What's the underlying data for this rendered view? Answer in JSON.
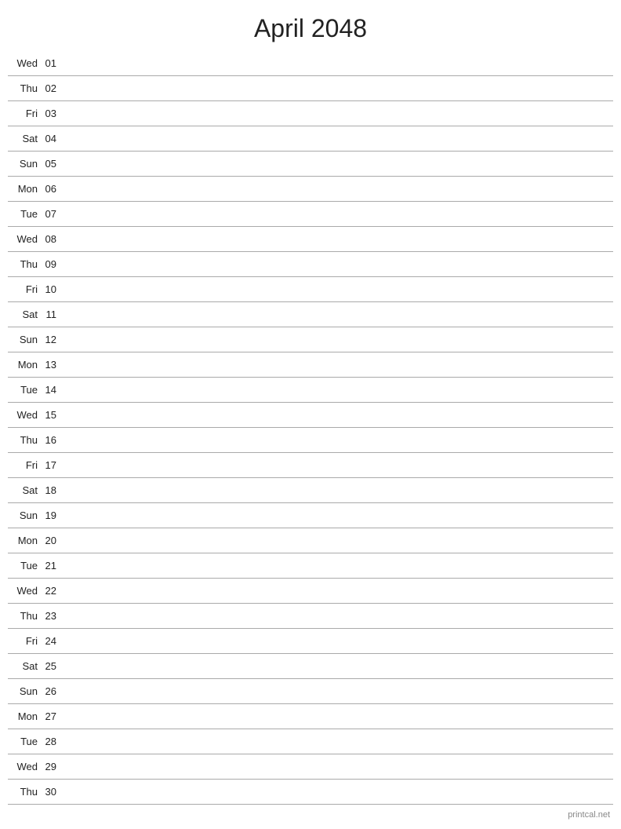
{
  "title": "April 2048",
  "days": [
    {
      "name": "Wed",
      "number": "01"
    },
    {
      "name": "Thu",
      "number": "02"
    },
    {
      "name": "Fri",
      "number": "03"
    },
    {
      "name": "Sat",
      "number": "04"
    },
    {
      "name": "Sun",
      "number": "05"
    },
    {
      "name": "Mon",
      "number": "06"
    },
    {
      "name": "Tue",
      "number": "07"
    },
    {
      "name": "Wed",
      "number": "08"
    },
    {
      "name": "Thu",
      "number": "09"
    },
    {
      "name": "Fri",
      "number": "10"
    },
    {
      "name": "Sat",
      "number": "11"
    },
    {
      "name": "Sun",
      "number": "12"
    },
    {
      "name": "Mon",
      "number": "13"
    },
    {
      "name": "Tue",
      "number": "14"
    },
    {
      "name": "Wed",
      "number": "15"
    },
    {
      "name": "Thu",
      "number": "16"
    },
    {
      "name": "Fri",
      "number": "17"
    },
    {
      "name": "Sat",
      "number": "18"
    },
    {
      "name": "Sun",
      "number": "19"
    },
    {
      "name": "Mon",
      "number": "20"
    },
    {
      "name": "Tue",
      "number": "21"
    },
    {
      "name": "Wed",
      "number": "22"
    },
    {
      "name": "Thu",
      "number": "23"
    },
    {
      "name": "Fri",
      "number": "24"
    },
    {
      "name": "Sat",
      "number": "25"
    },
    {
      "name": "Sun",
      "number": "26"
    },
    {
      "name": "Mon",
      "number": "27"
    },
    {
      "name": "Tue",
      "number": "28"
    },
    {
      "name": "Wed",
      "number": "29"
    },
    {
      "name": "Thu",
      "number": "30"
    }
  ],
  "footer": "printcal.net"
}
